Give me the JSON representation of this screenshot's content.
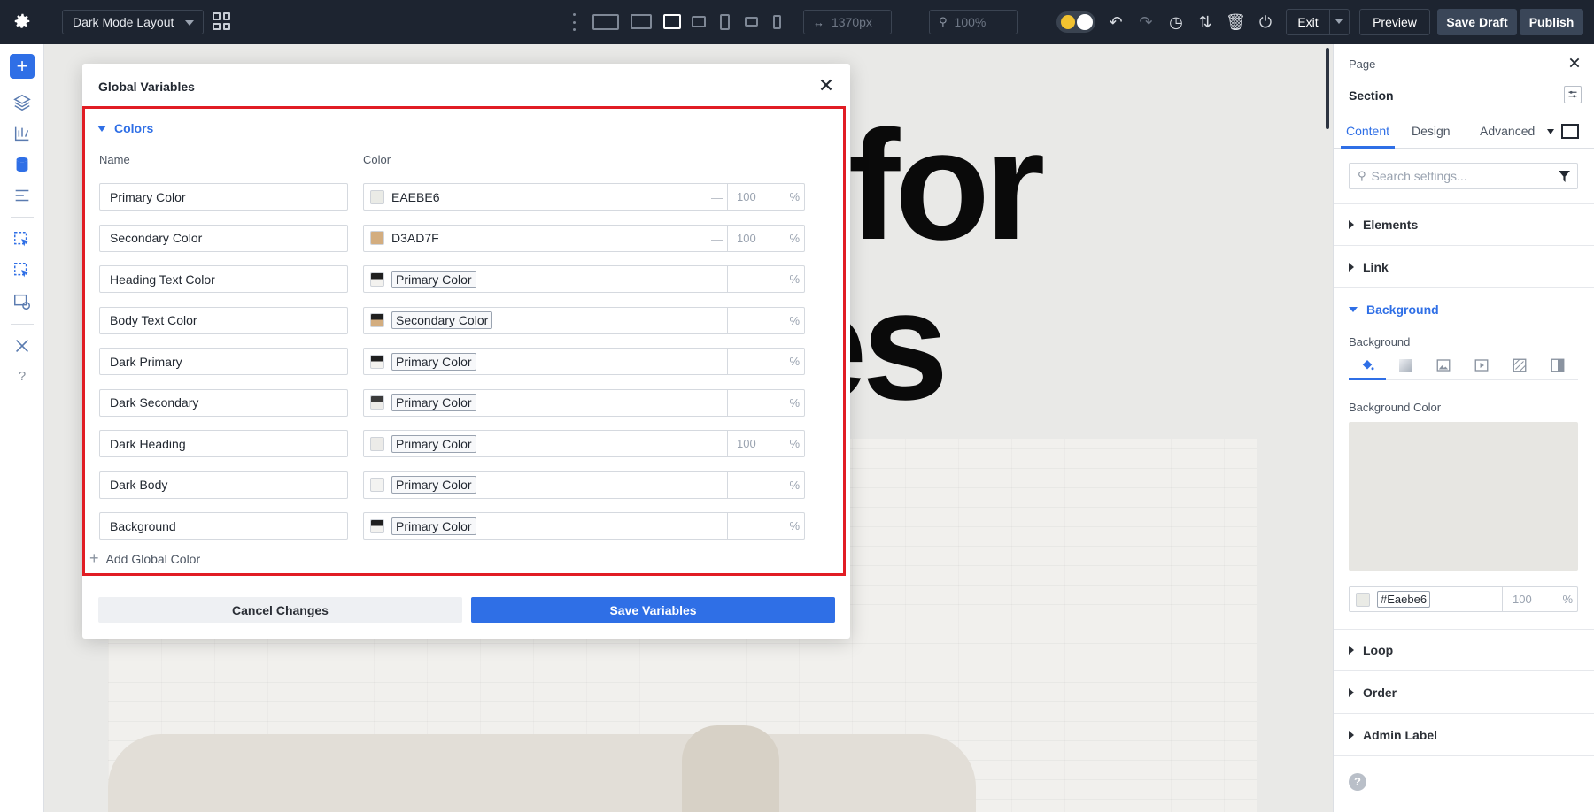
{
  "topbar": {
    "layout_name": "Dark Mode Layout",
    "width_value": "1370px",
    "zoom_value": "100%",
    "exit_label": "Exit",
    "preview_label": "Preview",
    "save_draft_label": "Save Draft",
    "publish_label": "Publish",
    "icons": [
      "gear-icon",
      "grid-icon",
      "desktop-wide-icon",
      "desktop-icon",
      "laptop-icon",
      "tablet-landscape-icon",
      "tablet-portrait-icon",
      "phone-landscape-icon",
      "phone-portrait-icon",
      "undo-icon",
      "redo-icon",
      "history-icon",
      "sort-icon",
      "trash-icon",
      "power-icon"
    ]
  },
  "canvas": {
    "hero_line1": "ls for",
    "hero_line2": "nes"
  },
  "modal": {
    "title": "Global Variables",
    "section_title": "Colors",
    "col_name": "Name",
    "col_color": "Color",
    "rows": [
      {
        "name": "Primary Color",
        "type": "hex",
        "value": "EAEBE6",
        "swatch": "#EAEBE6",
        "opacity": "100"
      },
      {
        "name": "Secondary Color",
        "type": "hex",
        "value": "D3AD7F",
        "swatch": "#D3AD7F",
        "opacity": "100"
      },
      {
        "name": "Heading Text Color",
        "type": "var",
        "value": "Primary Color",
        "swatch": "split",
        "opacity": ""
      },
      {
        "name": "Body Text Color",
        "type": "var",
        "value": "Secondary Color",
        "swatch": "split-tan",
        "opacity": ""
      },
      {
        "name": "Dark Primary",
        "type": "var",
        "value": "Primary Color",
        "swatch": "split",
        "opacity": ""
      },
      {
        "name": "Dark Secondary",
        "type": "var",
        "value": "Primary Color",
        "swatch": "split-light",
        "opacity": ""
      },
      {
        "name": "Dark Heading",
        "type": "var",
        "value": "Primary Color",
        "swatch": "#ECEBE8",
        "opacity": "100"
      },
      {
        "name": "Dark Body",
        "type": "var",
        "value": "Primary Color",
        "swatch": "#F3F3F1",
        "opacity": ""
      },
      {
        "name": "Background",
        "type": "var",
        "value": "Primary Color",
        "swatch": "split",
        "opacity": ""
      }
    ],
    "add_label": "Add Global Color",
    "cancel_label": "Cancel Changes",
    "save_label": "Save Variables",
    "opacity_suffix": "%"
  },
  "panel": {
    "crumb": "Page",
    "title": "Section",
    "tabs": [
      "Content",
      "Design",
      "Advanced"
    ],
    "search_placeholder": "Search settings...",
    "sections_top": [
      "Elements",
      "Link"
    ],
    "open_section": "Background",
    "background_label": "Background",
    "background_color_label": "Background Color",
    "bg_hex": "#Eaebe6",
    "bg_opacity": "100",
    "bg_opacity_suffix": "%",
    "sections_bottom": [
      "Loop",
      "Order",
      "Admin Label"
    ]
  },
  "colors": {
    "accent": "#2f6fe6",
    "topbar": "#1d2430",
    "highlight": "#e11d24"
  }
}
